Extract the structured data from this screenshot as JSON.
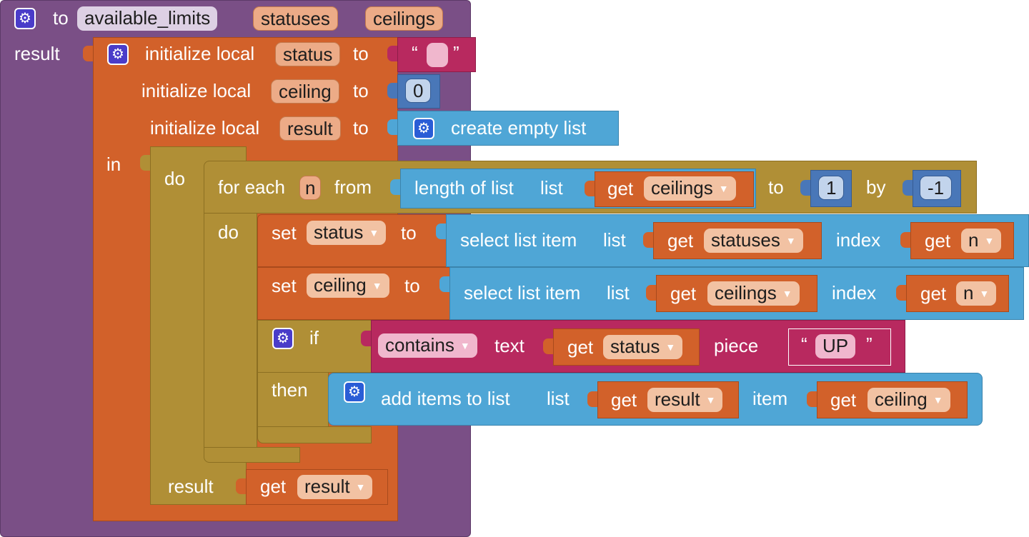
{
  "procedure": {
    "to_label": "to",
    "name": "available_limits",
    "params": [
      "statuses",
      "ceilings"
    ],
    "result_label": "result"
  },
  "local_block": {
    "init_label": "initialize local",
    "to_label": "to",
    "vars": [
      {
        "name": "status",
        "value_type": "text",
        "value": ""
      },
      {
        "name": "ceiling",
        "value_type": "number",
        "value": "0"
      },
      {
        "name": "result",
        "value_type": "list",
        "value": "create empty list"
      }
    ],
    "in_label": "in",
    "quote_open": "“",
    "quote_close": "”"
  },
  "do_block": {
    "do_label": "do",
    "result_label": "result",
    "get_label": "get",
    "result_var": "result"
  },
  "for_each": {
    "label": "for each",
    "var": "n",
    "from_label": "from",
    "length_label": "length of list",
    "list_label": "list",
    "get_label": "get",
    "list_var": "ceilings",
    "to_label": "to",
    "to_value": "1",
    "by_label": "by",
    "by_value": "-1",
    "do_label": "do"
  },
  "set_status": {
    "set_label": "set",
    "var": "status",
    "to_label": "to",
    "select_label": "select list item",
    "list_label": "list",
    "get_label": "get",
    "list_var": "statuses",
    "index_label": "index",
    "index_var": "n"
  },
  "set_ceiling": {
    "set_label": "set",
    "var": "ceiling",
    "to_label": "to",
    "select_label": "select list item",
    "list_label": "list",
    "get_label": "get",
    "list_var": "ceilings",
    "index_label": "index",
    "index_var": "n"
  },
  "if_block": {
    "if_label": "if",
    "then_label": "then",
    "contains_label": "contains",
    "text_label": "text",
    "get_label": "get",
    "text_var": "status",
    "piece_label": "piece",
    "piece_value": "UP",
    "quote_open": "“",
    "quote_close": "”"
  },
  "add_items": {
    "label": "add items to list",
    "list_label": "list",
    "get_label": "get",
    "list_var": "result",
    "item_label": "item",
    "item_var": "ceiling"
  },
  "colors": {
    "procedure": "#7a4f86",
    "variables": "#d2612a",
    "control": "#b08f36",
    "lists": "#4fa6d6",
    "text": "#b8295f",
    "math": "#4977b8"
  },
  "icons": {
    "mutator": "gear-icon",
    "dropdown": "caret-down-icon"
  }
}
